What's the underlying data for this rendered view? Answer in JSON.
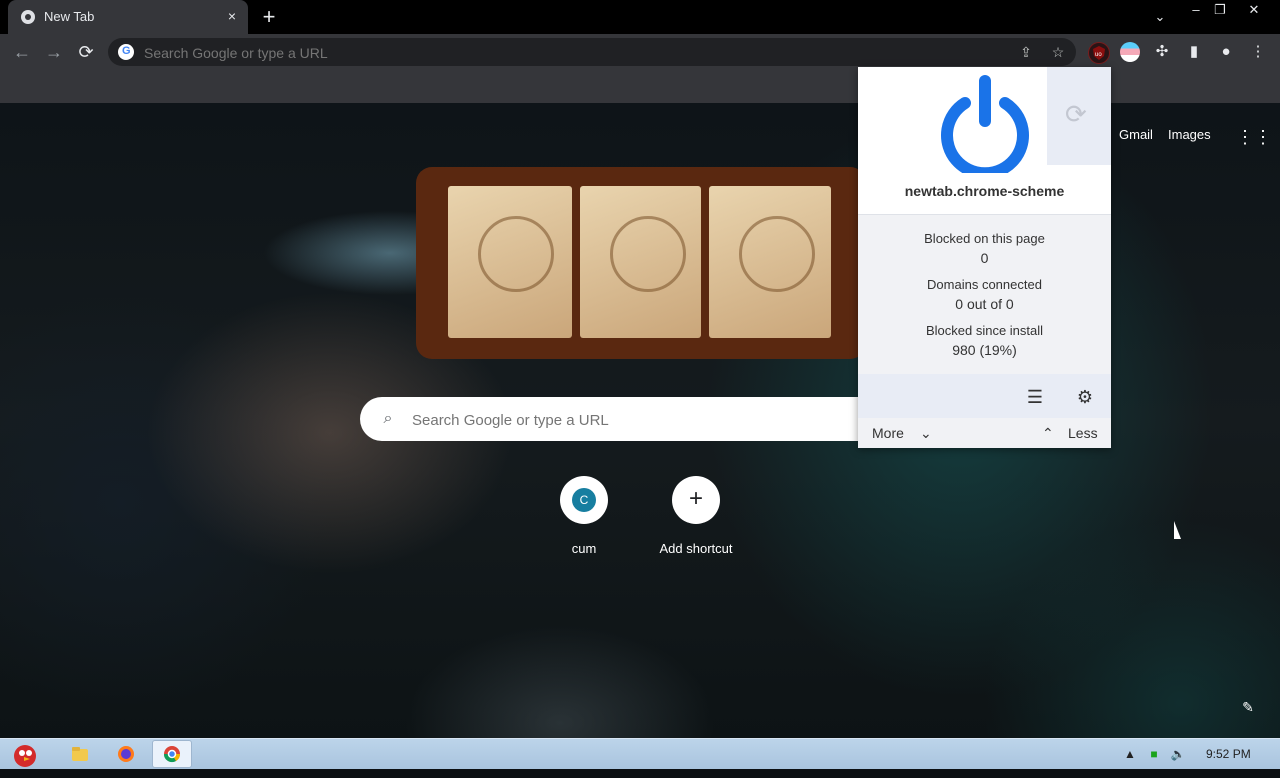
{
  "browser": {
    "tab": {
      "title": "New Tab",
      "favicon": "chrome-icon",
      "close": "×"
    },
    "new_tab": "+",
    "tab_search": "⌄",
    "window_controls": {
      "minimize": "–",
      "restore": "❐",
      "close": "✕"
    },
    "nav": {
      "back": "←",
      "forward": "→",
      "reload": "⟳"
    },
    "omnibox": {
      "google_letter": "G",
      "placeholder": "Search Google or type a URL",
      "share": "⇪",
      "bookmark": "☆"
    },
    "toolbar_icons": {
      "ublock": "uBlock Origin",
      "extensions": "✣",
      "side_panel": "▮",
      "profile": "●",
      "menu": "⋮"
    }
  },
  "newtab": {
    "top_links": {
      "gmail": "Gmail",
      "images": "Images",
      "apps": "⋮⋮"
    },
    "search": {
      "placeholder": "Search Google or type a URL",
      "icon": "⌕"
    },
    "shortcuts": [
      {
        "letter": "C",
        "label": "cum"
      },
      {
        "icon": "+",
        "label": "Add shortcut"
      }
    ],
    "customize": "✎"
  },
  "ublock_popup": {
    "hostname": "newtab.chrome-scheme",
    "refresh": "⟳",
    "stats": [
      {
        "label": "Blocked on this page",
        "value": "0"
      },
      {
        "label": "Domains connected",
        "value": "0 out of 0"
      },
      {
        "label": "Blocked since install",
        "value": "980 (19%)"
      }
    ],
    "tools": {
      "logger": "☰",
      "dashboard": "⚙"
    },
    "more": "More",
    "more_chevron": "⌄",
    "less": "Less",
    "less_chevron": "⌃",
    "power_color": "#1a73e8"
  },
  "taskbar": {
    "items": [
      "angry-birds-icon",
      "folder-icon",
      "firefox-icon",
      "chrome-icon"
    ],
    "tray": {
      "arrow": "▲",
      "network": "■",
      "volume": "🔈"
    },
    "clock": "9:52 PM"
  },
  "colors": {
    "tab_bg": "#35363a",
    "strip_bg": "#000000",
    "popup_accent": "#1a73e8",
    "taskbar": "#bcd4ea"
  }
}
